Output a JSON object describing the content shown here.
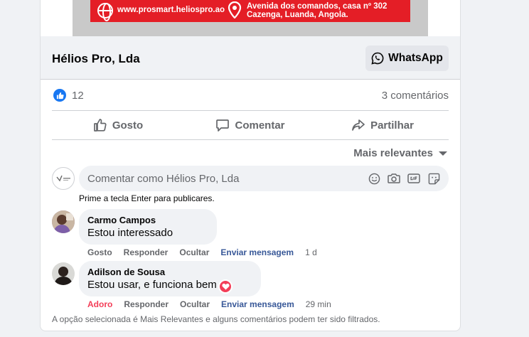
{
  "banner": {
    "url": "www.prosmart.heliospro.ao",
    "address_line1": "Avenida dos comandos, casa nº 302",
    "address_line2": "Cazenga, Luanda, Angola."
  },
  "page": {
    "name": "Hélios Pro, Lda",
    "whatsapp_label": "WhatsApp"
  },
  "stats": {
    "likes": "12",
    "comments": "3 comentários"
  },
  "actions": {
    "like": "Gosto",
    "comment": "Comentar",
    "share": "Partilhar"
  },
  "sort": {
    "label": "Mais relevantes"
  },
  "composer": {
    "placeholder": "Comentar como Hélios Pro, Lda",
    "hint": "Prime a tecla Enter para publicares."
  },
  "comments": [
    {
      "author": "Carmo Campos",
      "text": "Estou interessado",
      "react": "Gosto",
      "reply": "Responder",
      "hide": "Ocultar",
      "message": "Enviar mensagem",
      "time": "1 d"
    },
    {
      "author": "Adilson de Sousa",
      "text": "Estou usar, e funciona bem",
      "react": "Adoro",
      "reply": "Responder",
      "hide": "Ocultar",
      "message": "Enviar mensagem",
      "time": "29 min"
    }
  ],
  "footer_note": "A opção selecionada é Mais Relevantes e alguns comentários podem ter sido filtrados.",
  "colors": {
    "brand_blue": "#1877f2",
    "link_blue": "#385898",
    "love_red": "#f33e58",
    "banner_red": "#e41e26"
  }
}
